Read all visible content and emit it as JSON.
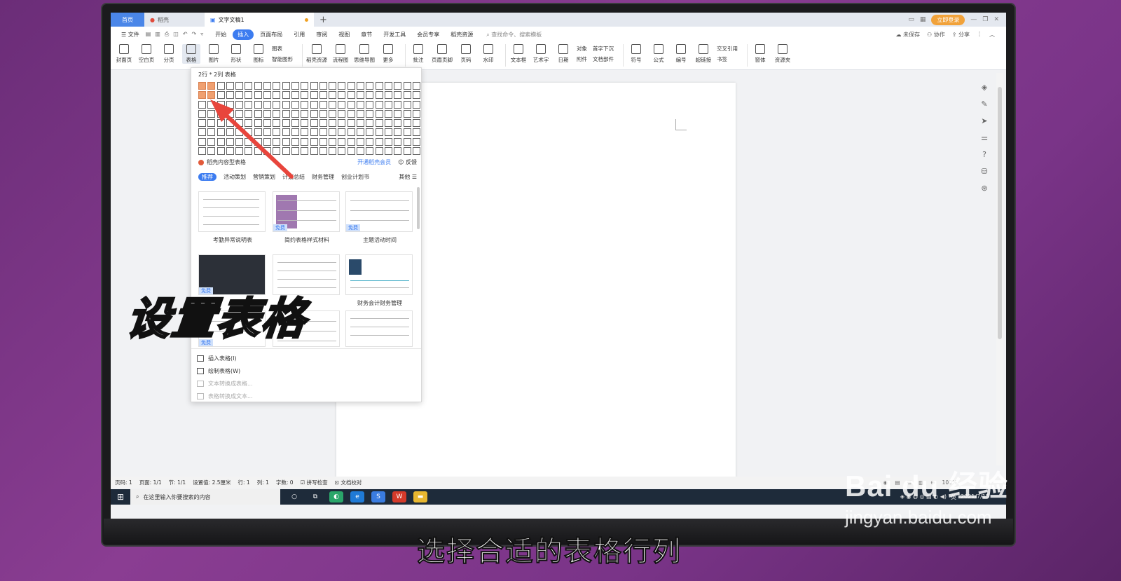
{
  "tabs": {
    "home": "首页",
    "dock": "稻壳",
    "doc": "文字文稿1",
    "login": "立即登录"
  },
  "menu": {
    "file": "文件",
    "items": [
      "开始",
      "插入",
      "页面布局",
      "引用",
      "审阅",
      "视图",
      "章节",
      "开发工具",
      "会员专享",
      "稻壳资源"
    ],
    "active_index": 1,
    "search": "查找命令、搜索模板",
    "save": "未保存",
    "collab": "协作",
    "share": "分享"
  },
  "ribbon": {
    "items": [
      {
        "label": "封面页",
        "icon": "cover-page-icon"
      },
      {
        "label": "空白页",
        "icon": "blank-page-icon"
      },
      {
        "label": "分页",
        "icon": "page-break-icon"
      },
      {
        "label": "表格",
        "icon": "table-icon"
      },
      {
        "label": "图片",
        "icon": "picture-icon"
      },
      {
        "label": "形状",
        "icon": "shape-icon"
      },
      {
        "label": "图标",
        "icon": "icon-icon"
      }
    ],
    "small1": [
      "图表",
      "智能图形"
    ],
    "items2": [
      {
        "label": "稻壳资源",
        "icon": "docer-icon"
      },
      {
        "label": "流程图",
        "icon": "flowchart-icon"
      },
      {
        "label": "思维导图",
        "icon": "mindmap-icon"
      },
      {
        "label": "更多",
        "icon": "more-icon"
      },
      {
        "label": "批注",
        "icon": "comment-icon"
      },
      {
        "label": "页眉页脚",
        "icon": "header-footer-icon"
      },
      {
        "label": "页码",
        "icon": "page-number-icon"
      },
      {
        "label": "水印",
        "icon": "watermark-icon"
      },
      {
        "label": "文本框",
        "icon": "textbox-icon"
      },
      {
        "label": "艺术字",
        "icon": "wordart-icon"
      },
      {
        "label": "日期",
        "icon": "date-icon"
      }
    ],
    "small2": [
      "对象",
      "附件"
    ],
    "small3": [
      "首字下沉",
      "文档部件"
    ],
    "items3": [
      {
        "label": "符号",
        "icon": "symbol-icon"
      },
      {
        "label": "公式",
        "icon": "formula-icon"
      },
      {
        "label": "编号",
        "icon": "numbering-icon"
      },
      {
        "label": "超链接",
        "icon": "hyperlink-icon"
      }
    ],
    "small4": [
      "交叉引用",
      "书签"
    ],
    "items4": [
      {
        "label": "窗体",
        "icon": "form-icon"
      },
      {
        "label": "资源夹",
        "icon": "resource-icon"
      }
    ]
  },
  "dropdown": {
    "grid_label": "2行 * 2列 表格",
    "rows": 8,
    "cols": 24,
    "sel_rows": 2,
    "sel_cols": 2,
    "docer_tables": "稻壳内容型表格",
    "vip": "开通稻壳会员",
    "feedback": "反馈",
    "categories": [
      "推荐",
      "活动策划",
      "营销策划",
      "计划总结",
      "财务管理",
      "创业计划书"
    ],
    "more": "其他",
    "templates": [
      "考勤异常说明表",
      "简约表格样式材料",
      "主题活动时间",
      "财务会计财务管理"
    ],
    "free": "免费",
    "actions": [
      {
        "label": "插入表格(I)",
        "enabled": true
      },
      {
        "label": "绘制表格(W)",
        "enabled": true
      },
      {
        "label": "文本转换成表格...",
        "enabled": false
      },
      {
        "label": "表格转换成文本...",
        "enabled": false
      }
    ]
  },
  "status": {
    "items": [
      "页码: 1",
      "页面: 1/1",
      "节: 1/1",
      "设置值: 2.5厘米",
      "行: 1",
      "列: 1",
      "字数: 0",
      "拼写检查",
      "文档校对"
    ],
    "zoom": "100%"
  },
  "taskbar": {
    "search": "在这里输入你要搜索的内容",
    "date": "2021/7/15",
    "lang": "英"
  },
  "overlay": {
    "title": "设置表格",
    "caption": "选择合适的表格行列"
  },
  "watermark": {
    "brand": "Bai du 经验",
    "url": "jingyan.baidu.com"
  }
}
